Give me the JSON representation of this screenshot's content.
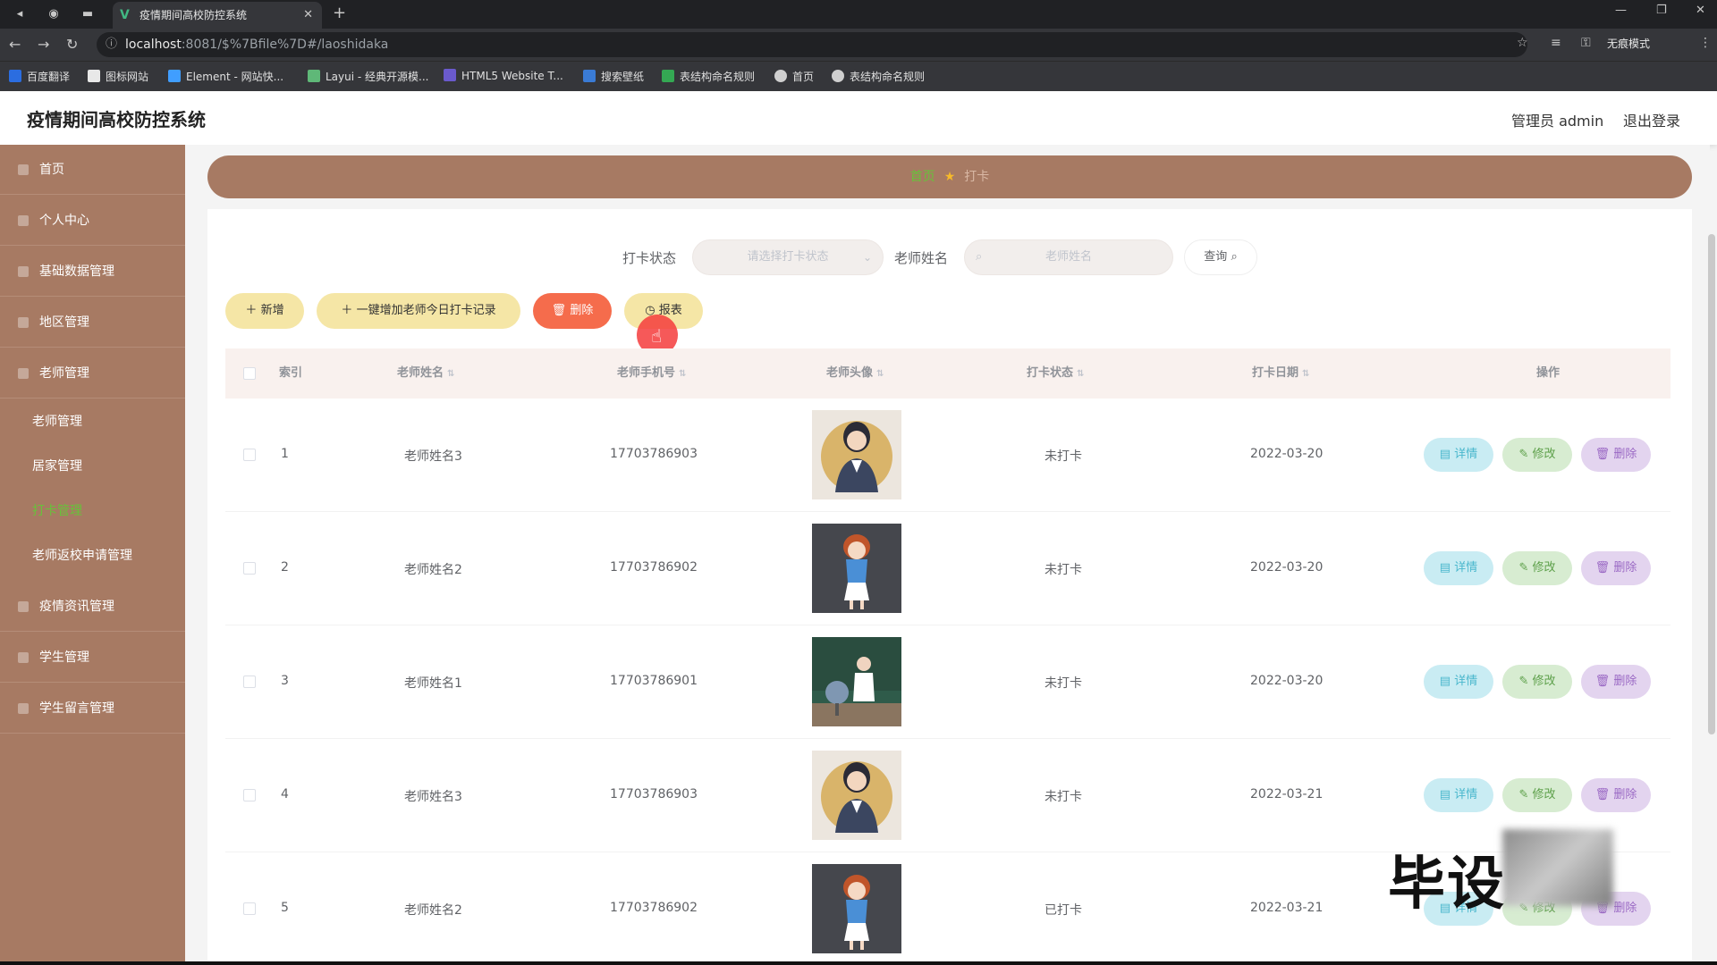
{
  "browser": {
    "tab_title": "疫情期间高校防控系统",
    "url_host": "localhost",
    "url_path": ":8081/$%7Bfile%7D#/laoshidaka",
    "incognito_label": "无痕模式",
    "bookmarks": [
      "百度翻译",
      "图标网站",
      "Element - 网站快...",
      "Layui - 经典开源模...",
      "HTML5 Website T...",
      "搜索壁纸",
      "表结构命名规则",
      "首页",
      "表结构命名规则"
    ]
  },
  "header": {
    "title": "疫情期间高校防控系统",
    "user": "管理员 admin",
    "logout": "退出登录"
  },
  "sidebar": {
    "items": [
      {
        "label": "首页"
      },
      {
        "label": "个人中心"
      },
      {
        "label": "基础数据管理"
      },
      {
        "label": "地区管理"
      },
      {
        "label": "老师管理"
      }
    ],
    "subitems": [
      {
        "label": "老师管理"
      },
      {
        "label": "居家管理"
      },
      {
        "label": "打卡管理"
      },
      {
        "label": "老师返校申请管理"
      }
    ],
    "items_after": [
      {
        "label": "疫情资讯管理"
      },
      {
        "label": "学生管理"
      },
      {
        "label": "学生留言管理"
      }
    ]
  },
  "breadcrumb": {
    "home": "首页",
    "current": "打卡"
  },
  "search": {
    "status_label": "打卡状态",
    "status_placeholder": "请选择打卡状态",
    "name_label": "老师姓名",
    "name_placeholder": "老师姓名",
    "query_button": "查询"
  },
  "toolbar": {
    "add": "新增",
    "batch_add": "一键增加老师今日打卡记录",
    "delete": "删除",
    "report": "报表"
  },
  "table": {
    "headers": {
      "index": "索引",
      "name": "老师姓名",
      "phone": "老师手机号",
      "avatar": "老师头像",
      "status": "打卡状态",
      "date": "打卡日期",
      "ops": "操作"
    },
    "row_actions": {
      "detail": "详情",
      "edit": "修改",
      "delete": "删除"
    },
    "rows": [
      {
        "index": "1",
        "name": "老师姓名3",
        "phone": "17703786903",
        "status": "未打卡",
        "date": "2022-03-20",
        "avatar": "teacher-3"
      },
      {
        "index": "2",
        "name": "老师姓名2",
        "phone": "17703786902",
        "status": "未打卡",
        "date": "2022-03-20",
        "avatar": "teacher-2"
      },
      {
        "index": "3",
        "name": "老师姓名1",
        "phone": "17703786901",
        "status": "未打卡",
        "date": "2022-03-20",
        "avatar": "teacher-1"
      },
      {
        "index": "4",
        "name": "老师姓名3",
        "phone": "17703786903",
        "status": "未打卡",
        "date": "2022-03-21",
        "avatar": "teacher-3"
      },
      {
        "index": "5",
        "name": "老师姓名2",
        "phone": "17703786902",
        "status": "已打卡",
        "date": "2022-03-21",
        "avatar": "teacher-2"
      }
    ]
  },
  "watermark": "毕设",
  "colors": {
    "sidebar": "#a77a63",
    "active_menu": "#67c23a",
    "delete_red": "#f56c4c",
    "toolbar_yellow": "#f5e6a6"
  }
}
